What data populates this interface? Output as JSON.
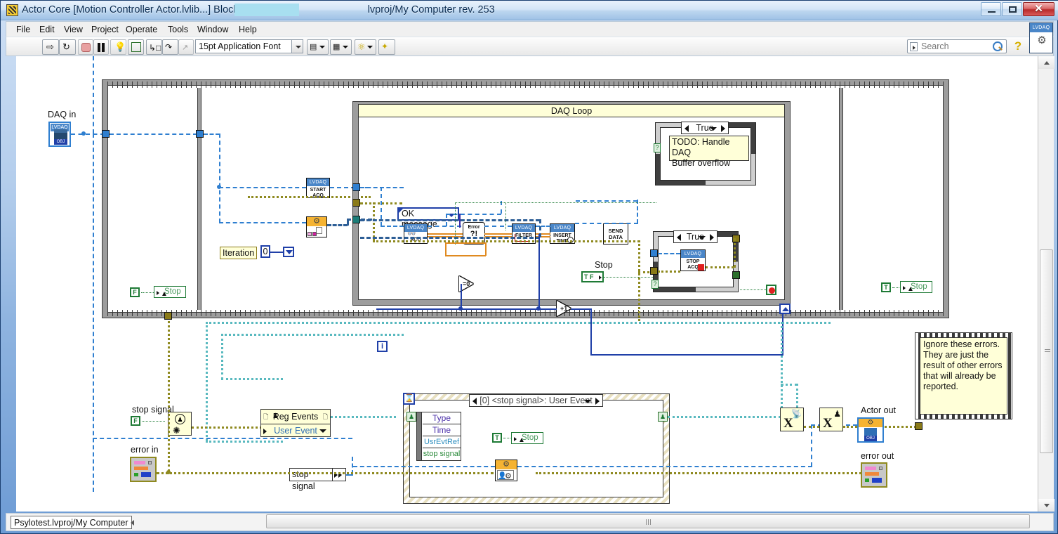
{
  "window": {
    "title": "Actor Core [Motion Controller Actor.lvlib...] Block Diagram on",
    "title_suffix": "lvproj/My Computer rev. 253",
    "minimize_label": "—",
    "maximize_label": "□",
    "close_label": "✕"
  },
  "menu": {
    "items": [
      {
        "label": "File"
      },
      {
        "label": "Edit"
      },
      {
        "label": "View"
      },
      {
        "label": "Project"
      },
      {
        "label": "Operate"
      },
      {
        "label": "Tools"
      },
      {
        "label": "Window"
      },
      {
        "label": "Help"
      }
    ]
  },
  "toolbar": {
    "run_icon": "run-arrow-icon",
    "run_continuous_icon": "run-continuously-icon",
    "abort_icon": "abort-execution-icon",
    "pause_icon": "pause-icon",
    "highlight_icon": "highlight-execution-lightbulb-icon",
    "retain_icon": "retain-wire-values-icon",
    "step_into_icon": "step-into-icon",
    "step_over_icon": "step-over-icon",
    "step_out_icon": "step-out-icon",
    "font_value": "15pt Application Font",
    "align_icon": "align-objects-icon",
    "distribute_icon": "distribute-objects-icon",
    "reorder_icon": "reorder-icon",
    "cleanup_icon": "clean-up-diagram-icon",
    "search_placeholder": "Search",
    "search_icon": "magnifier-icon",
    "help_icon": "question-mark-help-icon",
    "lvdaq_label": "LVDAQ",
    "lvdaq_icon": "gear-icon"
  },
  "statusbar": {
    "context": "Psylotest.lvproj/My Computer"
  },
  "diagram": {
    "daq_in_label": "DAQ in",
    "daq_in_terminal": "LVDAQ",
    "daq_in_obj": "OBJ",
    "stop_left": {
      "bool": "F",
      "label": "Stop"
    },
    "stop_right": {
      "bool": "T",
      "label": "Stop"
    },
    "start_acq": {
      "header": "LVDAQ",
      "line1": "START",
      "line2": "ACQ"
    },
    "config_vi_name": "config-gear-vi",
    "iteration_label": "Iteration",
    "iteration_const": "0",
    "daq_loop_title": "DAQ Loop",
    "ok_message": "OK message",
    "acq_vi": {
      "header": "LVDAQ",
      "line1": "ACQ"
    },
    "error_vi_label": "Error",
    "error_vi_mark": "?!",
    "filter_vi": {
      "header": "LVDAQ",
      "line1": "FILTER"
    },
    "insert_time_vi": {
      "header": "LVDAQ",
      "line1": "INSERT",
      "line2": "TIME"
    },
    "send_data_vi": {
      "line1": "SEND",
      "line2": "DATA"
    },
    "case_overflow": {
      "selector": "True",
      "note": "TODO: Handle DAQ\nBuffer overflow"
    },
    "case_stopacq": {
      "selector": "True"
    },
    "stop_acq_vi": {
      "header": "LVDAQ",
      "line1": "STOP",
      "line2": "ACQ"
    },
    "stop_inner_label": "Stop",
    "stop_inner_bool": "T F",
    "compare_zero": "=0",
    "increment": "+1",
    "i_terminal": "i",
    "stop_signal_label": "stop signal",
    "stop_signal_bool": "F",
    "reg_events": {
      "line1": "Reg Events",
      "line2": "User Event"
    },
    "stop_signal_const": "stop signal",
    "event_case": "[0] <stop signal>: User Event",
    "event_rows": [
      "Type",
      "Time",
      "UsrEvtRef",
      "stop signal"
    ],
    "event_stop": {
      "bool": "T",
      "label": "Stop"
    },
    "error_in_label": "error in",
    "error_out_label": "error out",
    "actor_out_label": "Actor out",
    "comment": "Ignore these errors. They are just the result of other errors that will already be reported.",
    "unregister_icon": "unregister-events-icon",
    "destroy_icon": "destroy-user-event-icon"
  },
  "colors": {
    "daq_blue": "#4a86c8",
    "wire_blue": "#2f7fd0",
    "wire_error": "#8f8a20",
    "wire_event": "#59b9bf",
    "structure_gray": "#9d9d9d",
    "note_yellow": "#ffffd8",
    "accent_orange": "#f5b332"
  }
}
